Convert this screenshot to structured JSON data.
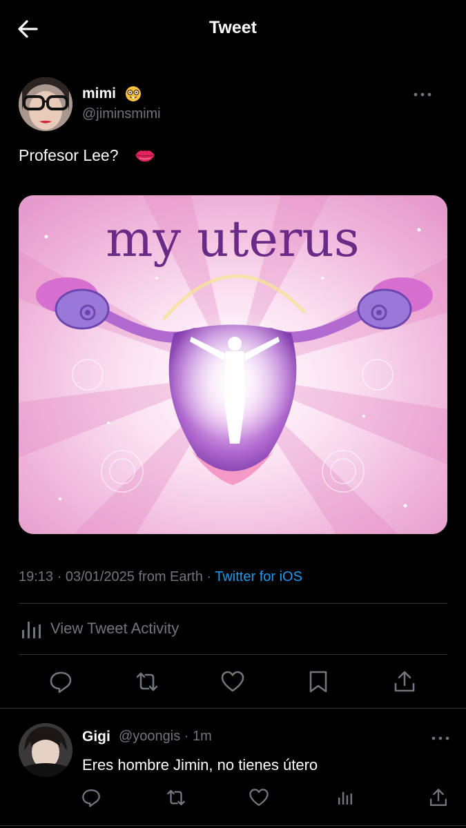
{
  "header": {
    "title": "Tweet"
  },
  "tweet": {
    "author_name": "mimi",
    "author_handle": "@jiminsmimi",
    "text": "Profesor Lee?",
    "image_title": "my uterus",
    "timestamp": "19:13 · 03/01/2025 from Earth · ",
    "source": "Twitter for iOS",
    "activity_label": "View Tweet Activity"
  },
  "reply": {
    "name": "Gigi",
    "handle_time": "@yoongis · 1m",
    "text": "Eres hombre Jimin, no tienes útero"
  },
  "colors": {
    "background": "#000000",
    "text": "#e7e9ea",
    "muted": "#71767b",
    "accent": "#1d9bf0",
    "divider": "#2f3336"
  },
  "icons": [
    "back-arrow-icon",
    "nerd-face-emoji-icon",
    "more-icon",
    "lips-emoji-icon",
    "bar-chart-icon",
    "reply-icon",
    "retweet-icon",
    "like-icon",
    "bookmark-icon",
    "share-icon"
  ]
}
